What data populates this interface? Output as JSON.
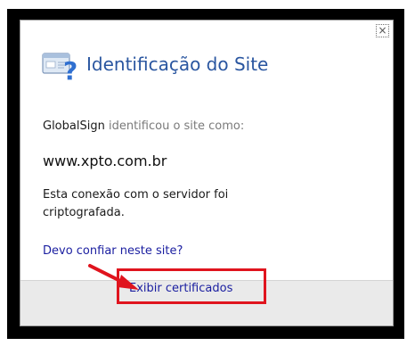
{
  "dialog": {
    "title": "Identificação do Site",
    "close_icon": "close-icon",
    "header_icon": "site-info-question-icon",
    "issuer": "GlobalSign",
    "identified_text": "identificou o site como:",
    "domain": "www.xpto.com.br",
    "description": "Esta conexão com o servidor foi criptografada.",
    "trust_link": "Devo confiar neste site?",
    "certificates_button": "Exibir certificados"
  },
  "colors": {
    "title_blue": "#2a56a0",
    "link_blue": "#1a1ea0",
    "highlight_red": "#e0141e",
    "frame_black": "#000000",
    "footer_gray": "#eaeaea"
  }
}
